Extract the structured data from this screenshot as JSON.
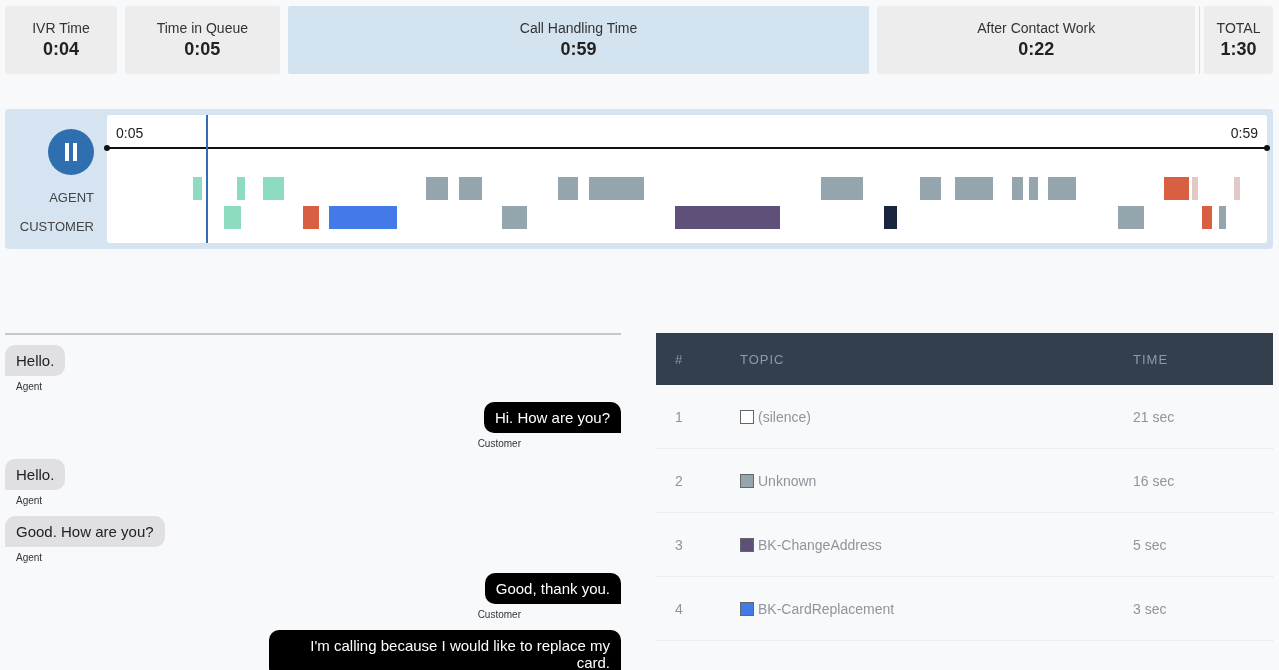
{
  "summary": [
    {
      "label": "IVR Time",
      "value": "0:04",
      "selected": false
    },
    {
      "label": "Time in Queue",
      "value": "0:05",
      "selected": false
    },
    {
      "label": "Call Handling Time",
      "value": "0:59",
      "selected": true
    },
    {
      "label": "After Contact Work",
      "value": "0:22",
      "selected": false
    },
    {
      "label": "TOTAL",
      "value": "1:30",
      "selected": false
    }
  ],
  "player": {
    "playing": true,
    "start": "0:05",
    "end": "0:59",
    "level": 0.085,
    "lanes": [
      {
        "label": "AGENT",
        "segments": [
          {
            "color": "#8ddcc0"
          },
          {
            "color": "#8ddcc0"
          },
          {
            "color": "#8ddcc0"
          },
          {
            "color": "#95a5ae"
          },
          {
            "color": "#95a5ae"
          },
          {
            "color": "#95a5ae"
          },
          {
            "color": "#95a5ae"
          },
          {
            "color": "#95a5ae"
          },
          {
            "color": "#95a5ae"
          },
          {
            "color": "#95a5ae"
          },
          {
            "color": "#95a5ae"
          },
          {
            "color": "#95a5ae"
          },
          {
            "color": "#95a5ae"
          },
          {
            "color": "#d95f43"
          },
          {
            "color": "#e3c8c8"
          },
          {
            "color": "#e3c8c8"
          }
        ]
      },
      {
        "label": "CUSTOMER",
        "segments": [
          {
            "color": "#8ddcc0"
          },
          {
            "color": "#d95f43"
          },
          {
            "color": "#4479e8"
          },
          {
            "color": "#95a5ae"
          },
          {
            "color": "#5e5079"
          },
          {
            "color": "#1a2540"
          },
          {
            "color": "#95a5ae"
          },
          {
            "color": "#d95f43"
          },
          {
            "color": "#95a5ae"
          }
        ]
      }
    ]
  },
  "transcript": [
    {
      "kind": "agent",
      "text": "Hello.",
      "label": "Agent"
    },
    {
      "kind": "customer",
      "text": "Hi. How are you?",
      "label": "Customer"
    },
    {
      "kind": "agent",
      "text": "Hello.",
      "label": "Agent"
    },
    {
      "kind": "agent",
      "text": "Good. How are you?",
      "label": "Agent"
    },
    {
      "kind": "customer",
      "text": "Good, thank you.",
      "label": "Customer"
    },
    {
      "kind": "customer",
      "text": "I'm calling because I would like to replace my card."
    }
  ],
  "topics": {
    "columns": [
      "#",
      "TOPIC",
      "TIME"
    ],
    "rows": [
      {
        "num": "1",
        "topic": "(silence)",
        "time": "21 sec",
        "color": "#ffffff"
      },
      {
        "num": "2",
        "topic": "Unknown",
        "time": "16 sec",
        "color": "#95a5ae"
      },
      {
        "num": "3",
        "topic": "BK-ChangeAddress",
        "time": "5 sec",
        "color": "#5e5079"
      },
      {
        "num": "4",
        "topic": "BK-CardReplacement",
        "time": "3 sec",
        "color": "#4479e8"
      }
    ]
  }
}
